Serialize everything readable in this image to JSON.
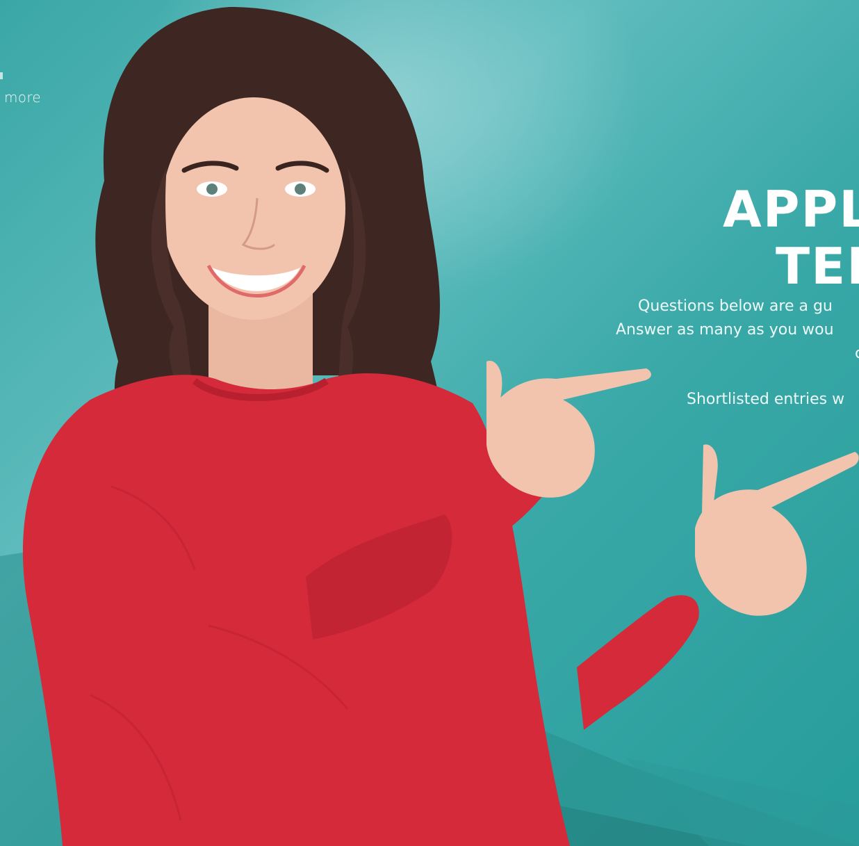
{
  "page": {
    "side_link": "more",
    "headline_line1": "APPL",
    "headline_line2": "TEM",
    "intro_line1": "Questions below are a gu",
    "intro_line2": "Answer as many as you wou",
    "intro_line3": "c",
    "intro_line4": "Shortlisted entries w"
  },
  "colors": {
    "background_teal": "#2a9d9b",
    "background_light": "#5fbcbd",
    "sweater_red": "#d42a3a",
    "hair_brown": "#3e2622",
    "skin": "#f2c4ae",
    "text_white": "#ffffff"
  }
}
